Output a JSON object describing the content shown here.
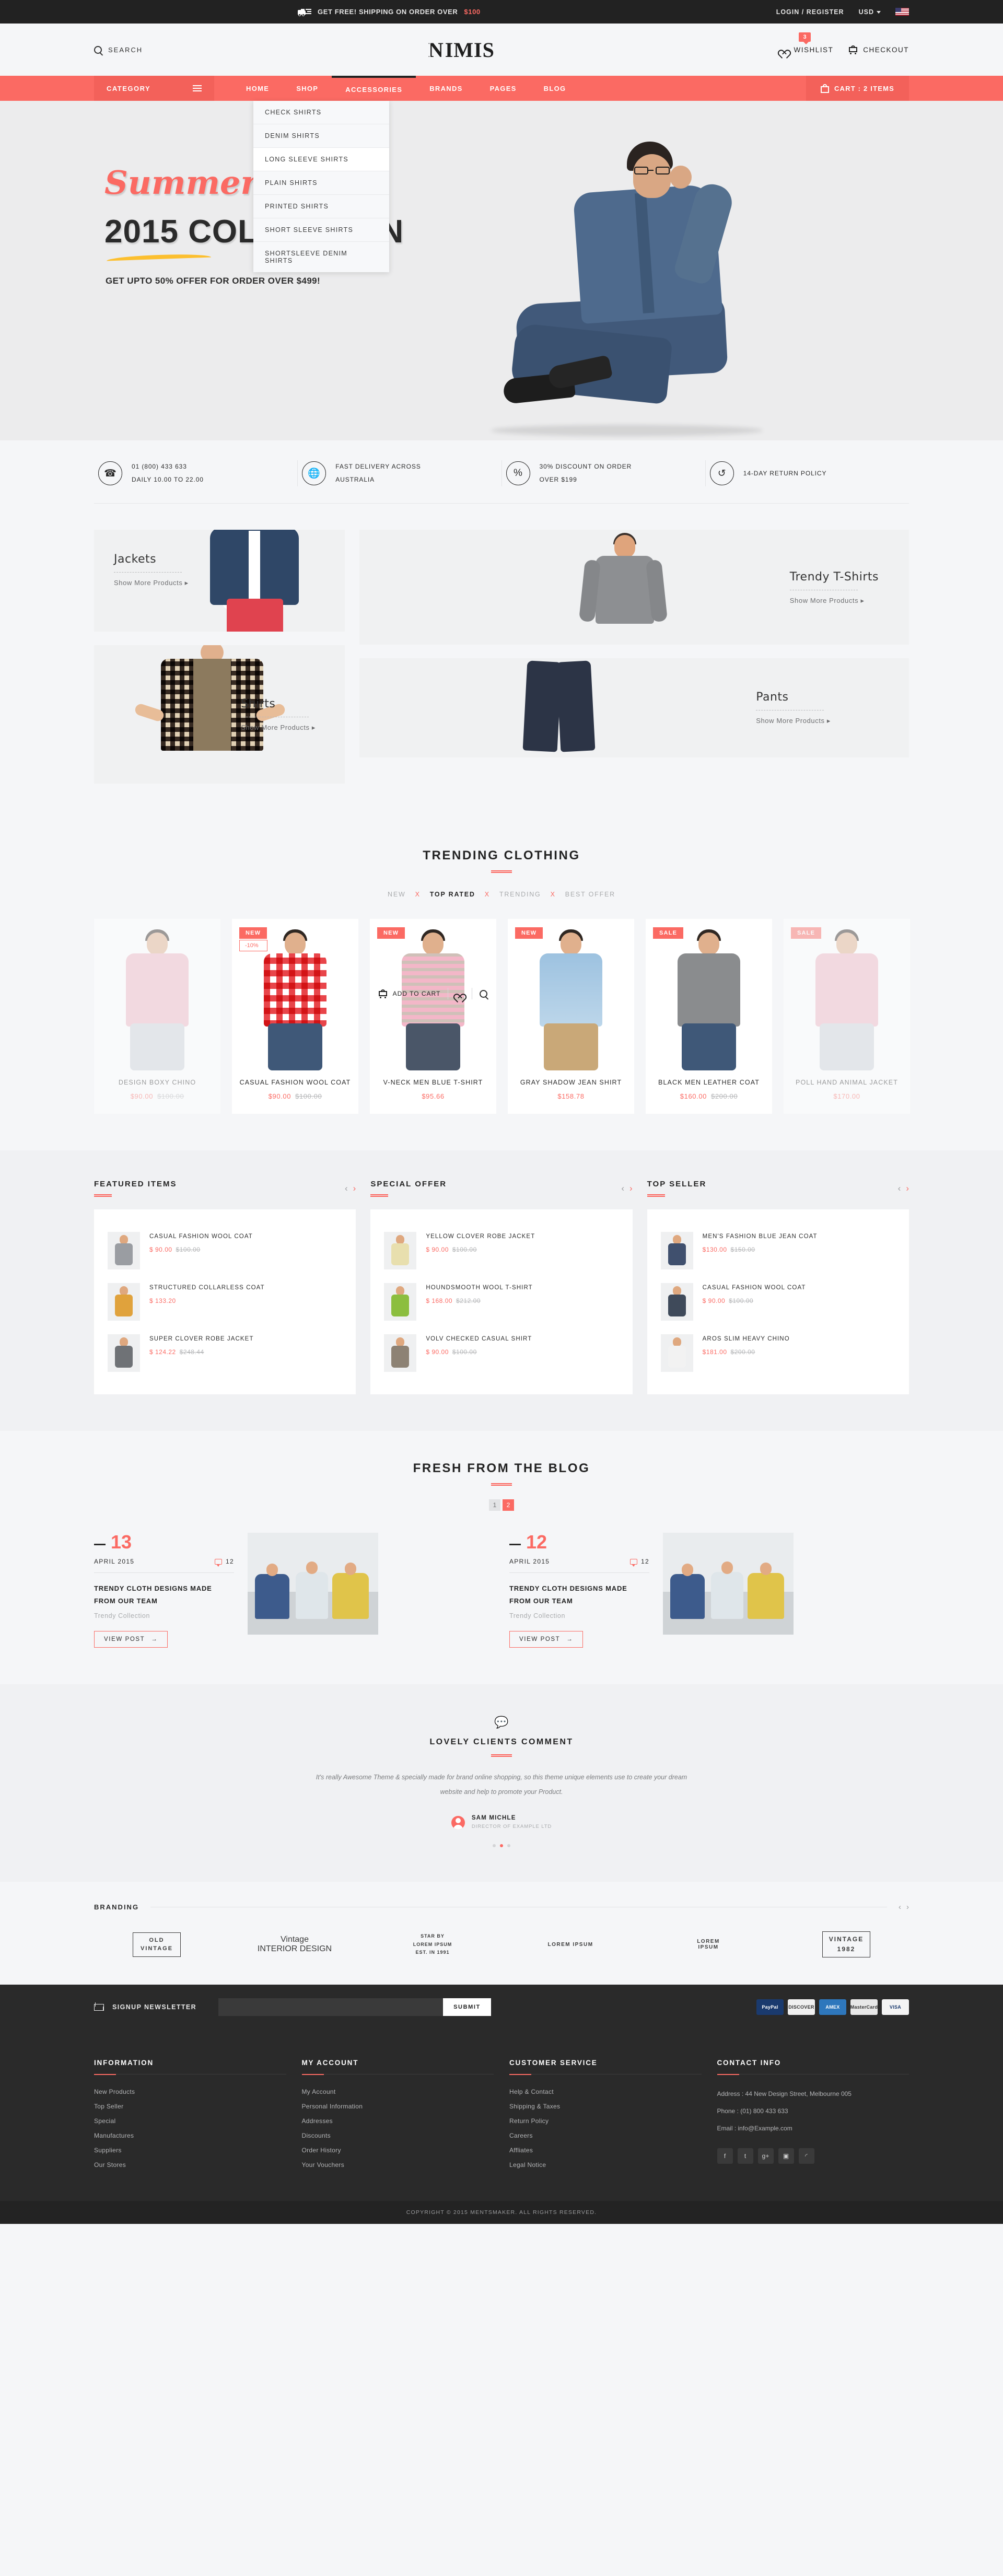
{
  "topbar": {
    "shipping_text": "GET FREE! SHIPPING ON ORDER OVER ",
    "shipping_amount": "$100",
    "login": "LOGIN / REGISTER",
    "currency": "USD",
    "flag": "us-flag-icon"
  },
  "header": {
    "search_label": "SEARCH",
    "logo_n": "N",
    "logo_rest": "IMIS",
    "wishlist_label": "WISHLIST",
    "wishlist_count": "3",
    "checkout_label": "CHECKOUT"
  },
  "nav": {
    "category_label": "CATEGORY",
    "items": [
      {
        "label": "HOME",
        "active": false
      },
      {
        "label": "SHOP",
        "active": false
      },
      {
        "label": "ACCESSORIES",
        "active": true
      },
      {
        "label": "BRANDS",
        "active": false
      },
      {
        "label": "PAGES",
        "active": false
      },
      {
        "label": "BLOG",
        "active": false
      }
    ],
    "cart_label": "CART : 2 ITEMS",
    "dropdown": [
      {
        "label": "CHECK SHIRTS",
        "hover": false
      },
      {
        "label": "DENIM SHIRTS",
        "hover": false
      },
      {
        "label": "LONG SLEEVE SHIRTS",
        "hover": true
      },
      {
        "label": "PLAIN SHIRTS",
        "hover": false
      },
      {
        "label": "PRINTED SHIRTS",
        "hover": false
      },
      {
        "label": "SHORT SLEEVE SHIRTS",
        "hover": false
      },
      {
        "label": "SHORTSLEEVE DENIM SHIRTS",
        "hover": false
      }
    ]
  },
  "hero": {
    "script_title": "Summer",
    "main_title": "2015 COLLECTION",
    "subtitle": "GET UPTO 50% OFFER FOR ORDER OVER $499!"
  },
  "services": [
    {
      "icon": "phone-icon",
      "line1": "01 (800) 433 633",
      "line2": "DAILY 10.00 TO 22.00"
    },
    {
      "icon": "globe-icon",
      "line1": "FAST DELIVERY ACROSS",
      "line2": "AUSTRALIA"
    },
    {
      "icon": "percent-icon",
      "line1": "30% DISCOUNT ON ORDER",
      "line2": "OVER $199"
    },
    {
      "icon": "return-icon",
      "line1": "14-DAY RETURN POLICY",
      "line2": ""
    }
  ],
  "categories": [
    {
      "title": "Jackets",
      "link": "Show More Products"
    },
    {
      "title": "Trendy T-Shirts",
      "link": "Show More Products"
    },
    {
      "title": "Shirts",
      "link": "Show More Products"
    },
    {
      "title": "Pants",
      "link": "Show More Products"
    }
  ],
  "trending": {
    "title": "TRENDING CLOTHING",
    "tabs": [
      {
        "label": "NEW",
        "active": false
      },
      {
        "label": "TOP RATED",
        "active": true
      },
      {
        "label": "TRENDING",
        "active": false
      },
      {
        "label": "BEST OFFER",
        "active": false
      }
    ],
    "separator": "X",
    "add_to_cart": "ADD TO CART",
    "products": [
      {
        "name": "DESIGN BOXY CHINO",
        "price": "$90.00",
        "old_price": "$100.00",
        "badge": "",
        "discount": "",
        "faded": true
      },
      {
        "name": "CASUAL FASHION WOOL COAT",
        "price": "$90.00",
        "old_price": "$100.00",
        "badge": "NEW",
        "discount": "-10%",
        "faded": false
      },
      {
        "name": "V-NECK MEN BLUE T-SHIRT",
        "price": "$95.66",
        "old_price": "",
        "badge": "NEW",
        "discount": "",
        "faded": false
      },
      {
        "name": "GRAY SHADOW JEAN SHIRT",
        "price": "$158.78",
        "old_price": "",
        "badge": "NEW",
        "discount": "",
        "faded": false
      },
      {
        "name": "BLACK MEN LEATHER COAT",
        "price": "$160.00",
        "old_price": "$200.00",
        "badge": "SALE",
        "discount": "",
        "faded": false
      },
      {
        "name": "POLL HAND ANIMAL JACKET",
        "price": "$170.00",
        "old_price": "",
        "badge": "SALE",
        "discount": "",
        "faded": true
      }
    ]
  },
  "widgets": [
    {
      "title": "FEATURED ITEMS",
      "items": [
        {
          "name": "CASUAL FASHION WOOL COAT",
          "price": "$ 90.00",
          "old_price": "$100.00",
          "color": "#9a9da2"
        },
        {
          "name": "STRUCTURED COLLARLESS COAT",
          "price": "$ 133.20",
          "old_price": "",
          "color": "#e0a23c"
        },
        {
          "name": "SUPER CLOVER ROBE JACKET",
          "price": "$ 124.22",
          "old_price": "$248.44",
          "color": "#6f7276"
        }
      ]
    },
    {
      "title": "SPECIAL OFFER",
      "items": [
        {
          "name": "YELLOW CLOVER ROBE JACKET",
          "price": "$ 90.00",
          "old_price": "$100.00",
          "color": "#e8dfae"
        },
        {
          "name": "HOUNDSMOOTH WOOL T-SHIRT",
          "price": "$ 168.00",
          "old_price": "$212.00",
          "color": "#8cbe3f"
        },
        {
          "name": "VOLV CHECKED CASUAL SHIRT",
          "price": "$ 90.00",
          "old_price": "$100.00",
          "color": "#8d8274"
        }
      ]
    },
    {
      "title": "TOP SELLER",
      "items": [
        {
          "name": "MEN'S FASHION BLUE JEAN COAT",
          "price": "$130.00",
          "old_price": "$150.00",
          "color": "#40506e"
        },
        {
          "name": "CASUAL FASHION WOOL COAT",
          "price": "$ 90.00",
          "old_price": "$100.00",
          "color": "#3f4a5a"
        },
        {
          "name": "AROS SLIM HEAVY CHINO",
          "price": "$181.00",
          "old_price": "$200.00",
          "color": "#f2f2f2"
        }
      ]
    }
  ],
  "blog": {
    "title": "FRESH FROM THE BLOG",
    "pages": [
      {
        "label": "1",
        "active": false
      },
      {
        "label": "2",
        "active": true
      }
    ],
    "view_post": "VIEW POST",
    "posts": [
      {
        "day": "13",
        "month": "APRIL 2015",
        "comments": "12",
        "title": "TRENDY CLOTH DESIGNS MADE FROM OUR TEAM",
        "category": "Trendy Collection"
      },
      {
        "day": "12",
        "month": "APRIL 2015",
        "comments": "12",
        "title": "TRENDY CLOTH DESIGNS MADE FROM OUR TEAM",
        "category": "Trendy Collection"
      }
    ]
  },
  "testimonial": {
    "title": "LOVELY CLIENTS COMMENT",
    "quote": "It's really Awesome Theme & specially made for brand online shopping, so this theme unique elements use to create your dream website and help to promote your Product.",
    "author": "SAM MICHLE",
    "role": "DIRECTOR OF EXAMPLE LTD",
    "dots": [
      false,
      true,
      false
    ]
  },
  "branding": {
    "title": "BRANDING",
    "logos": [
      {
        "line1": "OLD",
        "line2": "VINTAGE"
      },
      {
        "line1": "Vintage",
        "line2": "INTERIOR DESIGN"
      },
      {
        "line1": "STAR BY",
        "line2": "LOREM IPSUM",
        "line3": "EST. IN 1991"
      },
      {
        "line1": "LOREM IPSUM",
        "line2": ""
      },
      {
        "line1": "LOREM",
        "line2": "IPSUM"
      },
      {
        "line1": "VINTAGE",
        "line2": "1982"
      }
    ]
  },
  "newsletter": {
    "label": "SIGNUP NEWSLETTER",
    "placeholder": "",
    "submit": "SUBMIT",
    "payments": [
      {
        "name": "PayPal",
        "color": "#1a3a6e"
      },
      {
        "name": "DISCOVER",
        "color": "#f0f0f0",
        "text": "#333"
      },
      {
        "name": "AMEX",
        "color": "#2e77bc"
      },
      {
        "name": "MasterCard",
        "color": "#e8e8e8",
        "text": "#333"
      },
      {
        "name": "VISA",
        "color": "#f4f4f4",
        "text": "#1a3a6e"
      }
    ]
  },
  "footer": {
    "columns": [
      {
        "title": "INFORMATION",
        "links": [
          "New Products",
          "Top Seller",
          "Special",
          "Manufactures",
          "Suppliers",
          "Our Stores"
        ]
      },
      {
        "title": "MY ACCOUNT",
        "links": [
          "My Account",
          "Personal Information",
          "Addresses",
          "Discounts",
          "Order History",
          "Your Vouchers"
        ]
      },
      {
        "title": "CUSTOMER SERVICE",
        "links": [
          "Help & Contact",
          "Shipping & Taxes",
          "Return Policy",
          "Careers",
          "Affliates",
          "Legal Notice"
        ]
      }
    ],
    "contact": {
      "title": "CONTACT INFO",
      "address": "Address : 44 New Design Street, Melbourne 005",
      "phone": "Phone : (01) 800 433 633",
      "email": "Email : info@Example.com"
    },
    "socials": [
      "facebook-icon",
      "twitter-icon",
      "google-plus-icon",
      "instagram-icon",
      "rss-icon"
    ],
    "copyright": "COPYRIGHT © 2015 MENTSMAKER. ALL RIGHTS RESERVED."
  }
}
